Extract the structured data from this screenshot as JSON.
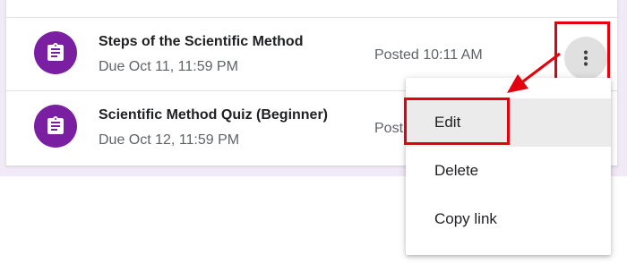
{
  "assignments": [
    {
      "title": "Steps of the Scientific Method",
      "due": "Due Oct 11, 11:59 PM",
      "posted": "Posted 10:11 AM"
    },
    {
      "title": "Scientific Method Quiz (Beginner)",
      "due": "Due Oct 12, 11:59 PM",
      "posted": "Post"
    }
  ],
  "menu": {
    "items": [
      {
        "label": "Edit"
      },
      {
        "label": "Delete"
      },
      {
        "label": "Copy link"
      }
    ]
  },
  "icons": {
    "assignment": "assignment-clipboard-icon",
    "more": "more-vert-icon"
  },
  "colors": {
    "accent": "#7b1fa2",
    "highlight": "#e3000f",
    "background_band": "#f1e9f5"
  }
}
